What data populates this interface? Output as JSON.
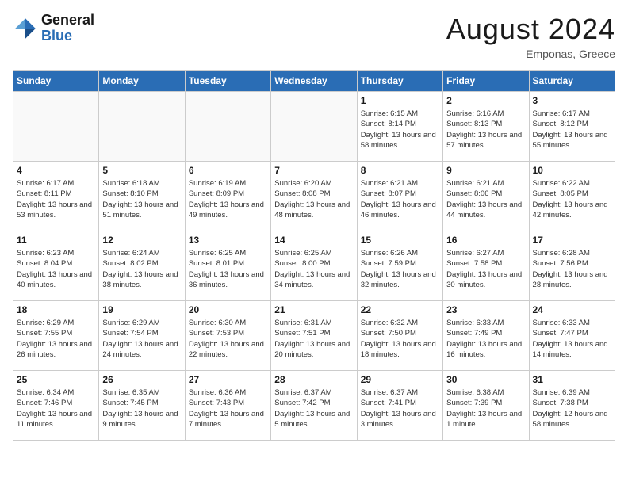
{
  "logo": {
    "text_general": "General",
    "text_blue": "Blue"
  },
  "header": {
    "title": "August 2024",
    "subtitle": "Emponas, Greece"
  },
  "weekdays": [
    "Sunday",
    "Monday",
    "Tuesday",
    "Wednesday",
    "Thursday",
    "Friday",
    "Saturday"
  ],
  "weeks": [
    [
      {
        "day": "",
        "sunrise": "",
        "sunset": "",
        "daylight": ""
      },
      {
        "day": "",
        "sunrise": "",
        "sunset": "",
        "daylight": ""
      },
      {
        "day": "",
        "sunrise": "",
        "sunset": "",
        "daylight": ""
      },
      {
        "day": "",
        "sunrise": "",
        "sunset": "",
        "daylight": ""
      },
      {
        "day": "1",
        "sunrise": "Sunrise: 6:15 AM",
        "sunset": "Sunset: 8:14 PM",
        "daylight": "Daylight: 13 hours and 58 minutes."
      },
      {
        "day": "2",
        "sunrise": "Sunrise: 6:16 AM",
        "sunset": "Sunset: 8:13 PM",
        "daylight": "Daylight: 13 hours and 57 minutes."
      },
      {
        "day": "3",
        "sunrise": "Sunrise: 6:17 AM",
        "sunset": "Sunset: 8:12 PM",
        "daylight": "Daylight: 13 hours and 55 minutes."
      }
    ],
    [
      {
        "day": "4",
        "sunrise": "Sunrise: 6:17 AM",
        "sunset": "Sunset: 8:11 PM",
        "daylight": "Daylight: 13 hours and 53 minutes."
      },
      {
        "day": "5",
        "sunrise": "Sunrise: 6:18 AM",
        "sunset": "Sunset: 8:10 PM",
        "daylight": "Daylight: 13 hours and 51 minutes."
      },
      {
        "day": "6",
        "sunrise": "Sunrise: 6:19 AM",
        "sunset": "Sunset: 8:09 PM",
        "daylight": "Daylight: 13 hours and 49 minutes."
      },
      {
        "day": "7",
        "sunrise": "Sunrise: 6:20 AM",
        "sunset": "Sunset: 8:08 PM",
        "daylight": "Daylight: 13 hours and 48 minutes."
      },
      {
        "day": "8",
        "sunrise": "Sunrise: 6:21 AM",
        "sunset": "Sunset: 8:07 PM",
        "daylight": "Daylight: 13 hours and 46 minutes."
      },
      {
        "day": "9",
        "sunrise": "Sunrise: 6:21 AM",
        "sunset": "Sunset: 8:06 PM",
        "daylight": "Daylight: 13 hours and 44 minutes."
      },
      {
        "day": "10",
        "sunrise": "Sunrise: 6:22 AM",
        "sunset": "Sunset: 8:05 PM",
        "daylight": "Daylight: 13 hours and 42 minutes."
      }
    ],
    [
      {
        "day": "11",
        "sunrise": "Sunrise: 6:23 AM",
        "sunset": "Sunset: 8:04 PM",
        "daylight": "Daylight: 13 hours and 40 minutes."
      },
      {
        "day": "12",
        "sunrise": "Sunrise: 6:24 AM",
        "sunset": "Sunset: 8:02 PM",
        "daylight": "Daylight: 13 hours and 38 minutes."
      },
      {
        "day": "13",
        "sunrise": "Sunrise: 6:25 AM",
        "sunset": "Sunset: 8:01 PM",
        "daylight": "Daylight: 13 hours and 36 minutes."
      },
      {
        "day": "14",
        "sunrise": "Sunrise: 6:25 AM",
        "sunset": "Sunset: 8:00 PM",
        "daylight": "Daylight: 13 hours and 34 minutes."
      },
      {
        "day": "15",
        "sunrise": "Sunrise: 6:26 AM",
        "sunset": "Sunset: 7:59 PM",
        "daylight": "Daylight: 13 hours and 32 minutes."
      },
      {
        "day": "16",
        "sunrise": "Sunrise: 6:27 AM",
        "sunset": "Sunset: 7:58 PM",
        "daylight": "Daylight: 13 hours and 30 minutes."
      },
      {
        "day": "17",
        "sunrise": "Sunrise: 6:28 AM",
        "sunset": "Sunset: 7:56 PM",
        "daylight": "Daylight: 13 hours and 28 minutes."
      }
    ],
    [
      {
        "day": "18",
        "sunrise": "Sunrise: 6:29 AM",
        "sunset": "Sunset: 7:55 PM",
        "daylight": "Daylight: 13 hours and 26 minutes."
      },
      {
        "day": "19",
        "sunrise": "Sunrise: 6:29 AM",
        "sunset": "Sunset: 7:54 PM",
        "daylight": "Daylight: 13 hours and 24 minutes."
      },
      {
        "day": "20",
        "sunrise": "Sunrise: 6:30 AM",
        "sunset": "Sunset: 7:53 PM",
        "daylight": "Daylight: 13 hours and 22 minutes."
      },
      {
        "day": "21",
        "sunrise": "Sunrise: 6:31 AM",
        "sunset": "Sunset: 7:51 PM",
        "daylight": "Daylight: 13 hours and 20 minutes."
      },
      {
        "day": "22",
        "sunrise": "Sunrise: 6:32 AM",
        "sunset": "Sunset: 7:50 PM",
        "daylight": "Daylight: 13 hours and 18 minutes."
      },
      {
        "day": "23",
        "sunrise": "Sunrise: 6:33 AM",
        "sunset": "Sunset: 7:49 PM",
        "daylight": "Daylight: 13 hours and 16 minutes."
      },
      {
        "day": "24",
        "sunrise": "Sunrise: 6:33 AM",
        "sunset": "Sunset: 7:47 PM",
        "daylight": "Daylight: 13 hours and 14 minutes."
      }
    ],
    [
      {
        "day": "25",
        "sunrise": "Sunrise: 6:34 AM",
        "sunset": "Sunset: 7:46 PM",
        "daylight": "Daylight: 13 hours and 11 minutes."
      },
      {
        "day": "26",
        "sunrise": "Sunrise: 6:35 AM",
        "sunset": "Sunset: 7:45 PM",
        "daylight": "Daylight: 13 hours and 9 minutes."
      },
      {
        "day": "27",
        "sunrise": "Sunrise: 6:36 AM",
        "sunset": "Sunset: 7:43 PM",
        "daylight": "Daylight: 13 hours and 7 minutes."
      },
      {
        "day": "28",
        "sunrise": "Sunrise: 6:37 AM",
        "sunset": "Sunset: 7:42 PM",
        "daylight": "Daylight: 13 hours and 5 minutes."
      },
      {
        "day": "29",
        "sunrise": "Sunrise: 6:37 AM",
        "sunset": "Sunset: 7:41 PM",
        "daylight": "Daylight: 13 hours and 3 minutes."
      },
      {
        "day": "30",
        "sunrise": "Sunrise: 6:38 AM",
        "sunset": "Sunset: 7:39 PM",
        "daylight": "Daylight: 13 hours and 1 minute."
      },
      {
        "day": "31",
        "sunrise": "Sunrise: 6:39 AM",
        "sunset": "Sunset: 7:38 PM",
        "daylight": "Daylight: 12 hours and 58 minutes."
      }
    ]
  ]
}
